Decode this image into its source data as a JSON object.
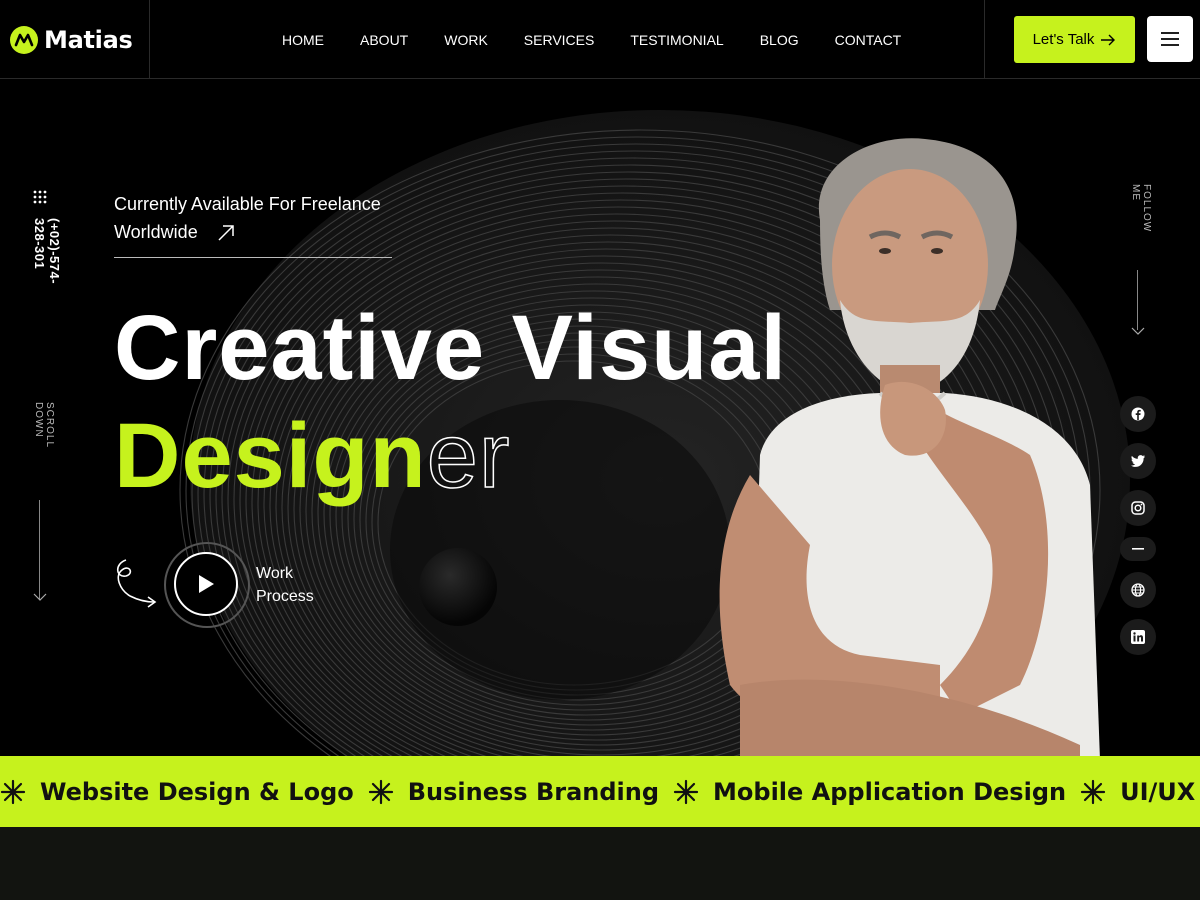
{
  "brand": {
    "name": "Matias",
    "accent": "#c6f21d"
  },
  "nav": {
    "items": [
      "HOME",
      "ABOUT",
      "WORK",
      "SERVICES",
      "TESTIMONIAL",
      "BLOG",
      "CONTACT"
    ]
  },
  "header": {
    "cta_label": "Let's Talk",
    "cta_icon": "arrow-right-icon",
    "menu_icon": "hamburger-icon"
  },
  "side_left": {
    "phone": "(+02)-574-328-301",
    "scroll_label": "SCROLL DOWN"
  },
  "side_right": {
    "follow_label": "FOLLOW ME",
    "socials": [
      "facebook-icon",
      "twitter-icon",
      "instagram-icon",
      "minus-icon",
      "globe-icon",
      "linkedin-icon"
    ]
  },
  "hero": {
    "availability_line1": "Currently Available For Freelance",
    "availability_line2": "Worldwide",
    "title_line1": "Creative Visual",
    "title_line2_green": "Design",
    "title_line2_outline": "er",
    "work_line1": "Work",
    "work_line2": "Process"
  },
  "marquee": {
    "items": [
      "Website Design & Logo",
      "Business Branding",
      "Mobile Application Design",
      "UI/UX Mobi"
    ]
  }
}
